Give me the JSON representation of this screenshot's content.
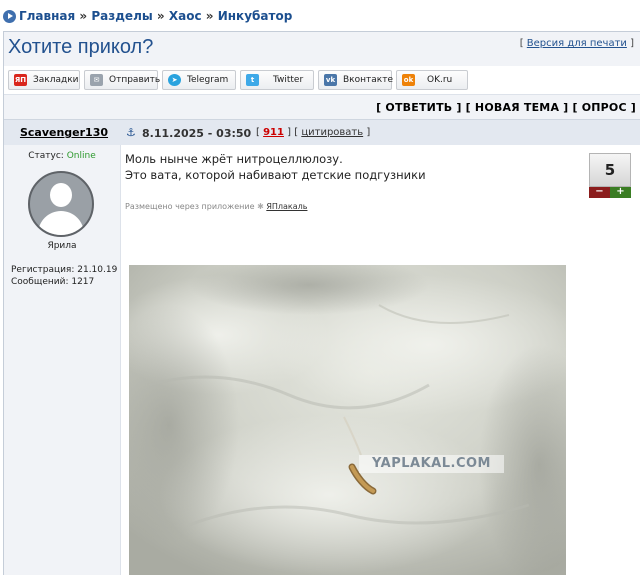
{
  "breadcrumb": {
    "items": [
      "Главная",
      "Разделы",
      "Хаос",
      "Инкубатор"
    ],
    "separator": "»"
  },
  "topic": {
    "title": "Хотите прикол?",
    "print_prefix": "[",
    "print_link": "Версия для печати",
    "print_suffix": "]"
  },
  "share": [
    {
      "label": "Закладки",
      "icon": "yaplakal-icon",
      "color": "#d9261c",
      "glyph": "ЯП"
    },
    {
      "label": "Отправить",
      "icon": "mail-icon",
      "color": "#9aa3ad",
      "glyph": "✉"
    },
    {
      "label": "Telegram",
      "icon": "telegram-icon",
      "color": "#2aa3de",
      "glyph": "➤"
    },
    {
      "label": "Twitter",
      "icon": "twitter-icon",
      "color": "#3ea9e8",
      "glyph": "t"
    },
    {
      "label": "Вконтакте",
      "icon": "vk-icon",
      "color": "#4a76a8",
      "glyph": "vk"
    },
    {
      "label": "OK.ru",
      "icon": "ok-icon",
      "color": "#ee8208",
      "glyph": "ok"
    }
  ],
  "actions": {
    "text": "[ ОТВЕТИТЬ ] [ НОВАЯ ТЕМА ] [ ОПРОС ]"
  },
  "post": {
    "author": "Scavenger130",
    "anchor_glyph": "⚓",
    "date": "8.11.2025 - 03:50",
    "number": "911",
    "cite": "цитировать",
    "status_label": "Статус:",
    "status_value": "Online",
    "rank": "Ярила",
    "registration": "Регистрация: 21.10.19",
    "messages": "Сообщений: 1217",
    "text_line1": "Моль нынче жрёт нитроцеллюлозу.",
    "text_line2": "Это вата, которой набивают детские подгузники",
    "via_prefix": "Размещено через приложение",
    "via_app": "ЯПлакаль",
    "rating": "5",
    "rating_minus": "−",
    "rating_plus": "+",
    "watermark": "YAPLAKAL.COM"
  },
  "colors": {
    "link": "#1c4f8f",
    "online": "#2e9a2e",
    "post_number": "#cc0000",
    "header_bg": "#f1f3f7"
  }
}
